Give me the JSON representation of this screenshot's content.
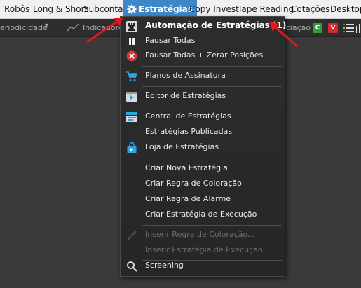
{
  "menubar": {
    "items": [
      "Robôs",
      "Long & Short",
      "Subcontas",
      "Estratégias",
      "Copy Invest",
      "Tape Reading",
      "Cotações",
      "Desktop"
    ]
  },
  "toolbar": {
    "periodicidade": "eriodicidade",
    "indicadores": "Indicadores",
    "right_label": "ociação",
    "badges": [
      "C",
      "V"
    ]
  },
  "dropdown": {
    "items": [
      {
        "label": "Automação de Estratégias (1)",
        "icon": "chess-rook-icon"
      },
      {
        "label": "Pausar Todas",
        "icon": "pause-icon"
      },
      {
        "label": "Pausar Todas + Zerar Posições",
        "icon": "red-x-circle-icon"
      },
      {
        "label": "Planos de Assinatura",
        "icon": "shopping-cart-icon"
      },
      {
        "label": "Editor de Estratégias",
        "icon": "play-window-icon"
      },
      {
        "label": "Central de Estratégias",
        "icon": "central-icon"
      },
      {
        "label": "Estratégias Publicadas",
        "icon": ""
      },
      {
        "label": "Loja de Estratégias",
        "icon": "shopping-bag-icon"
      },
      {
        "label": "Criar Nova Estratégia",
        "icon": ""
      },
      {
        "label": "Criar Regra de Coloração",
        "icon": ""
      },
      {
        "label": "Criar Regra de Alarme",
        "icon": ""
      },
      {
        "label": "Criar Estratégia de Execução",
        "icon": ""
      },
      {
        "label": "Inserir Regra de Coloração...",
        "icon": "",
        "disabled": true
      },
      {
        "label": "Inserir Estratégia de Execução...",
        "icon": "",
        "disabled": true
      },
      {
        "label": "Screening",
        "icon": "search-icon"
      }
    ]
  },
  "colors": {
    "accent": "#3c86c9",
    "badge_c": "#2e9e3e",
    "badge_v": "#d42a2a",
    "annotation_arrow": "#e0181b"
  }
}
